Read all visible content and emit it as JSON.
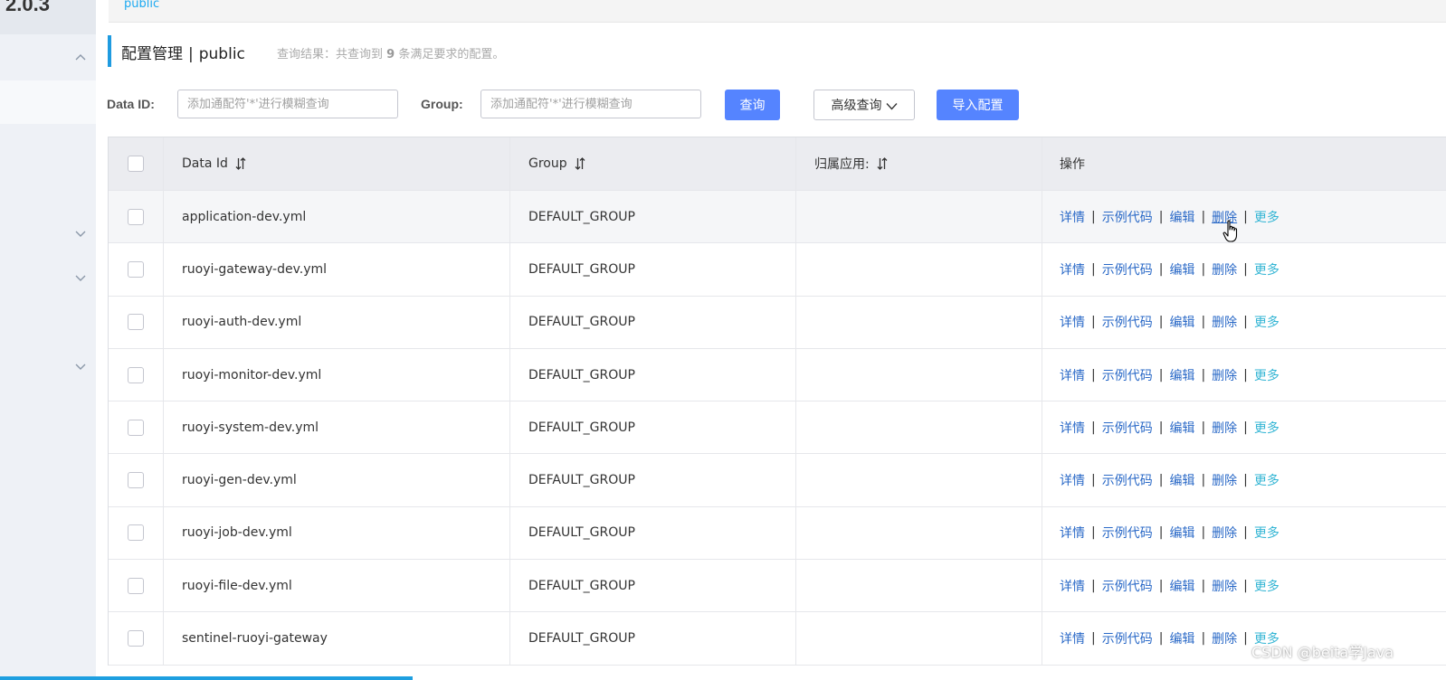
{
  "sidebar": {
    "version_label": "2.0.3",
    "chevrons": [
      "^",
      "v",
      "v",
      "v"
    ]
  },
  "namespace_bar": {
    "link": "public"
  },
  "header": {
    "title": "配置管理",
    "separator": "|",
    "namespace": "public",
    "query_result_prefix": "查询结果：共查询到",
    "query_result_count": "9",
    "query_result_suffix": "条满足要求的配置。"
  },
  "search": {
    "data_id_label": "Data ID:",
    "data_id_placeholder": "添加通配符'*'进行模糊查询",
    "group_label": "Group:",
    "group_placeholder": "添加通配符'*'进行模糊查询",
    "query_button": "查询",
    "advanced_button": "高级查询",
    "import_button": "导入配置"
  },
  "table": {
    "columns": [
      "Data Id",
      "Group",
      "归属应用:",
      "操作"
    ],
    "operations": [
      "详情",
      "示例代码",
      "编辑",
      "删除",
      "更多"
    ],
    "rows": [
      {
        "data_id": "application-dev.yml",
        "group": "DEFAULT_GROUP",
        "app": ""
      },
      {
        "data_id": "ruoyi-gateway-dev.yml",
        "group": "DEFAULT_GROUP",
        "app": ""
      },
      {
        "data_id": "ruoyi-auth-dev.yml",
        "group": "DEFAULT_GROUP",
        "app": ""
      },
      {
        "data_id": "ruoyi-monitor-dev.yml",
        "group": "DEFAULT_GROUP",
        "app": ""
      },
      {
        "data_id": "ruoyi-system-dev.yml",
        "group": "DEFAULT_GROUP",
        "app": ""
      },
      {
        "data_id": "ruoyi-gen-dev.yml",
        "group": "DEFAULT_GROUP",
        "app": ""
      },
      {
        "data_id": "ruoyi-job-dev.yml",
        "group": "DEFAULT_GROUP",
        "app": ""
      },
      {
        "data_id": "ruoyi-file-dev.yml",
        "group": "DEFAULT_GROUP",
        "app": ""
      },
      {
        "data_id": "sentinel-ruoyi-gateway",
        "group": "DEFAULT_GROUP",
        "app": ""
      }
    ]
  },
  "watermark": "CSDN @beita学Java",
  "colors": {
    "primary": "#5584ff",
    "link": "#2a69c7",
    "more_link": "#33b5d4",
    "accent_bar": "#1f9be0"
  }
}
